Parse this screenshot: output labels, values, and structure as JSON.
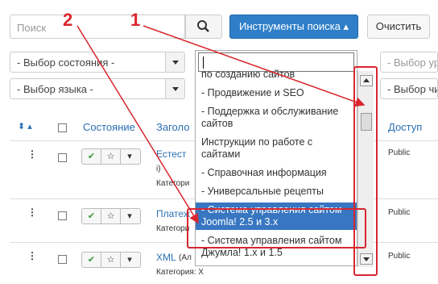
{
  "toolbar": {
    "search_placeholder": "Поиск",
    "tools_label": "Инструменты поиска ▴",
    "clear_label": "Очистить"
  },
  "filters": {
    "state": "- Выбор состояния -",
    "language": "- Выбор языка -",
    "right_top": "- Выбор ур",
    "right_bottom": "- Выбор чи"
  },
  "table": {
    "state_header": "Состояние",
    "title_header": "Заголо",
    "access_header": "Доступ",
    "rows": [
      {
        "title": "Естест",
        "line2": "i)",
        "category": "Категори",
        "access": "Public"
      },
      {
        "title": "Платеж",
        "line2": "",
        "category": "Категори",
        "access": "Public"
      },
      {
        "title": "XML",
        "line2": "(Ал",
        "category": "Категория: X",
        "access": "Public"
      }
    ]
  },
  "dropdown": {
    "items": [
      "по созданию сайтов",
      "- Продвижение и SEO",
      "- Поддержка и обслуживание сайтов",
      "Инструкции по работе с сайтами",
      "- Справочная информация",
      "- Универсальные рецепты",
      "- Система управления сайтом Joomla! 2.5 и 3.x",
      "- Система управления сайтом Джумла! 1.x и 1.5"
    ],
    "selected_index": 6
  },
  "annotations": {
    "label_1": "1",
    "label_2": "2"
  },
  "colors": {
    "accent": "#2f7fc8",
    "highlight": "#3876c1",
    "annotation": "#d9262e"
  }
}
